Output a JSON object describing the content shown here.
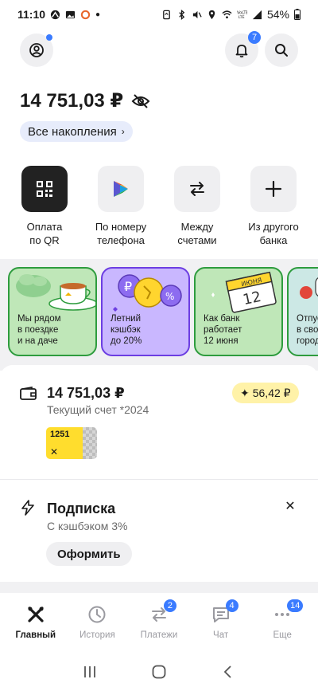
{
  "status_bar": {
    "time": "11:10",
    "battery": "54%"
  },
  "header": {
    "notifications_count": "7"
  },
  "balance": {
    "amount": "14 751,03 ₽",
    "savings_label": "Все накопления"
  },
  "quick_actions": [
    {
      "label_line1": "Оплата",
      "label_line2": "по QR",
      "icon": "qr-icon"
    },
    {
      "label_line1": "По номеру",
      "label_line2": "телефона",
      "icon": "sbp-icon"
    },
    {
      "label_line1": "Между",
      "label_line2": "счетами",
      "icon": "transfer-arrows-icon"
    },
    {
      "label_line1": "Из другого",
      "label_line2": "банка",
      "icon": "plus-icon"
    }
  ],
  "stories": [
    {
      "line1": "Мы рядом",
      "line2": "в поездке",
      "line3": "и на даче"
    },
    {
      "line1": "Летний",
      "line2": "кэшбэк",
      "line3": "до 20%"
    },
    {
      "line1": "Как банк",
      "line2": "работает",
      "line3": "12 июня"
    },
    {
      "line1": "Отпус",
      "line2": "в свое",
      "line3": "город"
    }
  ],
  "story_calendar": {
    "month": "ИЮНЯ",
    "day": "12"
  },
  "account": {
    "amount": "14 751,03 ₽",
    "name": "Текущий счет *2024",
    "cashback": "56,42 ₽",
    "card_last4": "1251"
  },
  "subscription": {
    "title": "Подписка",
    "description": "С кэшбэком 3%",
    "button": "Оформить"
  },
  "bottom_nav": [
    {
      "label": "Главный",
      "badge": "",
      "icon": "home-tools-icon",
      "active": true
    },
    {
      "label": "История",
      "badge": "",
      "icon": "clock-icon",
      "active": false
    },
    {
      "label": "Платежи",
      "badge": "2",
      "icon": "payments-arrows-icon",
      "active": false
    },
    {
      "label": "Чат",
      "badge": "4",
      "icon": "chat-icon",
      "active": false
    },
    {
      "label": "Еще",
      "badge": "14",
      "icon": "more-dots-icon",
      "active": false
    }
  ],
  "colors": {
    "accent_blue": "#3a7bff",
    "brand_yellow": "#ffdd2d",
    "cashback_bg": "#fff2a8"
  }
}
